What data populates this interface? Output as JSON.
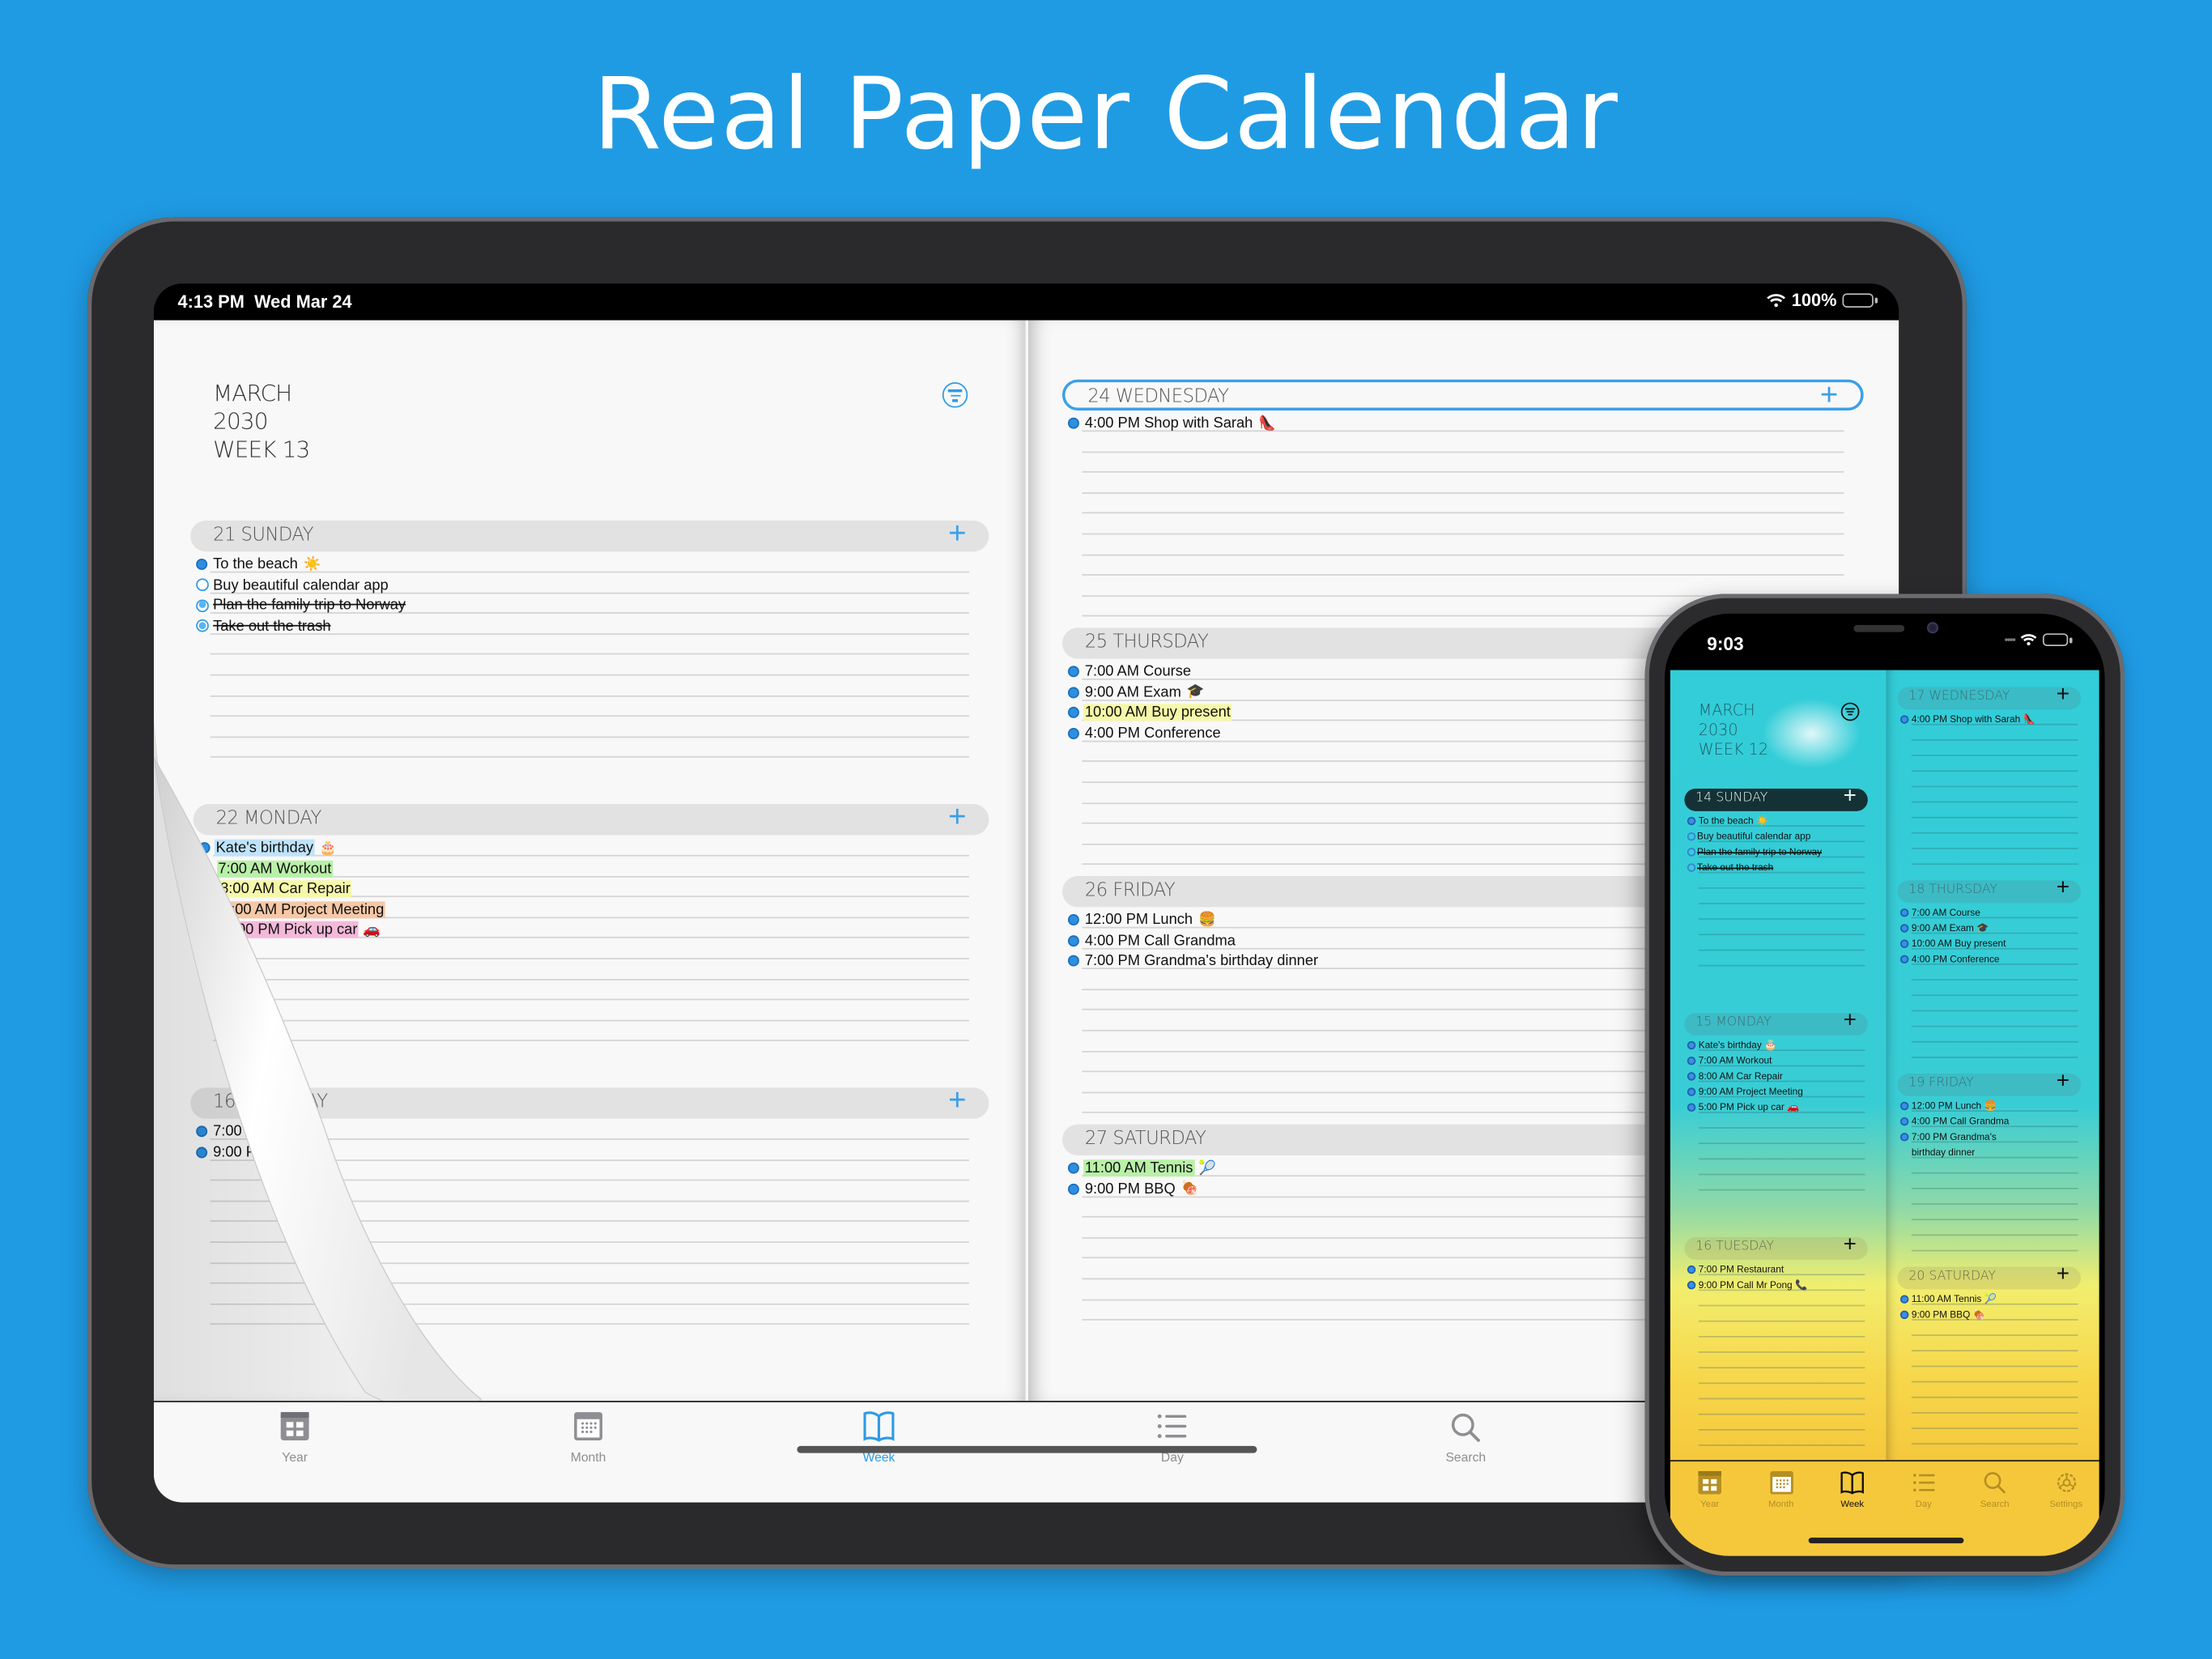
{
  "hero": {
    "title": "Real Paper Calendar"
  },
  "ipad": {
    "status": {
      "time": "4:13 PM",
      "date": "Wed Mar 24",
      "battery": "100%",
      "battery_level": 1.0
    },
    "header": {
      "month": "MARCH",
      "year": "2030",
      "week": "WEEK 13"
    },
    "days": [
      {
        "label": "21 SUNDAY",
        "today": false,
        "events": [
          {
            "text": "To the beach",
            "emoji": "☀️",
            "kind": "dot"
          },
          {
            "text": "Buy beautiful calendar app",
            "kind": "ring"
          },
          {
            "text": "Plan the family trip to Norway",
            "kind": "ring-done",
            "strike": true
          },
          {
            "text": "Take out the trash",
            "kind": "ring-done",
            "strike": true
          }
        ]
      },
      {
        "label": "22 MONDAY",
        "today": false,
        "events": [
          {
            "text": "Kate's birthday",
            "emoji": "🎂",
            "kind": "dot",
            "highlight": "blue"
          },
          {
            "text": "7:00 AM Workout",
            "kind": "dot",
            "highlight": "green"
          },
          {
            "text": "8:00 AM Car Repair",
            "kind": "dot",
            "highlight": "yellow"
          },
          {
            "text": "9:00 AM Project Meeting",
            "kind": "dot",
            "highlight": "orange"
          },
          {
            "text": "5:00 PM Pick up car",
            "emoji": "🚗",
            "kind": "dot",
            "highlight": "pink"
          }
        ]
      },
      {
        "label": "16 TUESDAY",
        "visible_label": "16 TUES",
        "tail": "AY",
        "today": false,
        "events": [
          {
            "text": "7:00 PM Res",
            "kind": "dot"
          },
          {
            "text": "9:00 PM Call",
            "emoji": "📞",
            "kind": "dot"
          }
        ]
      },
      {
        "label": "24 WEDNESDAY",
        "today": true,
        "events": [
          {
            "text": "4:00 PM Shop with Sarah",
            "emoji": "👠",
            "kind": "dot"
          }
        ]
      },
      {
        "label": "25 THURSDAY",
        "today": false,
        "events": [
          {
            "text": "7:00 AM Course",
            "kind": "dot"
          },
          {
            "text": "9:00 AM Exam",
            "emoji": "🎓",
            "kind": "dot"
          },
          {
            "text": "10:00 AM Buy present",
            "kind": "dot",
            "highlight": "yellow"
          },
          {
            "text": "4:00 PM Conference",
            "kind": "dot"
          }
        ]
      },
      {
        "label": "26 FRIDAY",
        "today": false,
        "events": [
          {
            "text": "12:00 PM Lunch",
            "emoji": "🍔",
            "kind": "dot"
          },
          {
            "text": "4:00 PM Call Grandma",
            "kind": "dot"
          },
          {
            "text": "7:00 PM Grandma's birthday dinner",
            "kind": "dot"
          }
        ]
      },
      {
        "label": "27 SATURDAY",
        "today": false,
        "events": [
          {
            "text": "11:00 AM Tennis",
            "emoji": "🎾",
            "kind": "dot",
            "highlight": "green"
          },
          {
            "text": "9:00 PM BBQ",
            "emoji": "🍖",
            "kind": "dot"
          }
        ]
      }
    ],
    "tabs": [
      {
        "label": "Year",
        "icon": "year-icon",
        "active": false
      },
      {
        "label": "Month",
        "icon": "month-icon",
        "active": false
      },
      {
        "label": "Week",
        "icon": "book-icon",
        "active": true
      },
      {
        "label": "Day",
        "icon": "list-icon",
        "active": false
      },
      {
        "label": "Search",
        "icon": "search-icon",
        "active": false
      }
    ],
    "colors": {
      "accent": "#2e9be6",
      "paper": "#f8f8f8",
      "header_bg": "#e2e2e2"
    }
  },
  "iphone": {
    "status": {
      "time": "9:03"
    },
    "header": {
      "month": "MARCH",
      "year": "2030",
      "week": "WEEK 12"
    },
    "days": [
      {
        "label": "14 SUNDAY",
        "today": true,
        "events": [
          {
            "text": "To the beach",
            "emoji": "☀️",
            "kind": "dot"
          },
          {
            "text": "Buy beautiful calendar app",
            "kind": "ring"
          },
          {
            "text": "Plan the family trip to Norway",
            "kind": "ring",
            "strike": true
          },
          {
            "text": "Take out the trash",
            "kind": "ring",
            "strike": true
          }
        ]
      },
      {
        "label": "15 MONDAY",
        "today": false,
        "events": [
          {
            "text": "Kate's birthday",
            "emoji": "🎂",
            "kind": "dot"
          },
          {
            "text": "7:00 AM Workout",
            "kind": "dot"
          },
          {
            "text": "8:00 AM Car Repair",
            "kind": "dot"
          },
          {
            "text": "9:00 AM Project Meeting",
            "kind": "dot"
          },
          {
            "text": "5:00 PM Pick up car",
            "emoji": "🚗",
            "kind": "dot"
          }
        ]
      },
      {
        "label": "16 TUESDAY",
        "today": false,
        "events": [
          {
            "text": "7:00 PM Restaurant",
            "kind": "dot"
          },
          {
            "text": "9:00 PM Call Mr Pong",
            "emoji": "📞",
            "kind": "dot"
          }
        ]
      },
      {
        "label": "17 WEDNESDAY",
        "today": false,
        "events": [
          {
            "text": "4:00 PM Shop with Sarah",
            "emoji": "👠",
            "kind": "dot"
          }
        ]
      },
      {
        "label": "18 THURSDAY",
        "today": false,
        "events": [
          {
            "text": "7:00 AM Course",
            "kind": "dot"
          },
          {
            "text": "9:00 AM Exam",
            "emoji": "🎓",
            "kind": "dot"
          },
          {
            "text": "10:00 AM Buy present",
            "kind": "dot"
          },
          {
            "text": "4:00 PM Conference",
            "kind": "dot"
          }
        ]
      },
      {
        "label": "19 FRIDAY",
        "today": false,
        "events": [
          {
            "text": "12:00 PM Lunch",
            "emoji": "🍔",
            "kind": "dot"
          },
          {
            "text": "4:00 PM Call Grandma",
            "kind": "dot"
          },
          {
            "text": "7:00 PM Grandma's",
            "kind": "dot"
          },
          {
            "text": "birthday dinner",
            "kind": "cont"
          }
        ]
      },
      {
        "label": "20 SATURDAY",
        "today": false,
        "events": [
          {
            "text": "11:00 AM Tennis",
            "emoji": "🎾",
            "kind": "dot"
          },
          {
            "text": "9:00 PM BBQ",
            "emoji": "🍖",
            "kind": "dot"
          }
        ]
      }
    ],
    "tabs": [
      {
        "label": "Year",
        "icon": "year-icon",
        "active": false
      },
      {
        "label": "Month",
        "icon": "month-icon",
        "active": false
      },
      {
        "label": "Week",
        "icon": "book-icon",
        "active": true
      },
      {
        "label": "Day",
        "icon": "list-icon",
        "active": false
      },
      {
        "label": "Search",
        "icon": "search-icon",
        "active": false
      },
      {
        "label": "Settings",
        "icon": "settings-icon",
        "active": false
      }
    ],
    "colors": {
      "sky": "#32cdd8",
      "sun": "#f5c83c"
    }
  }
}
